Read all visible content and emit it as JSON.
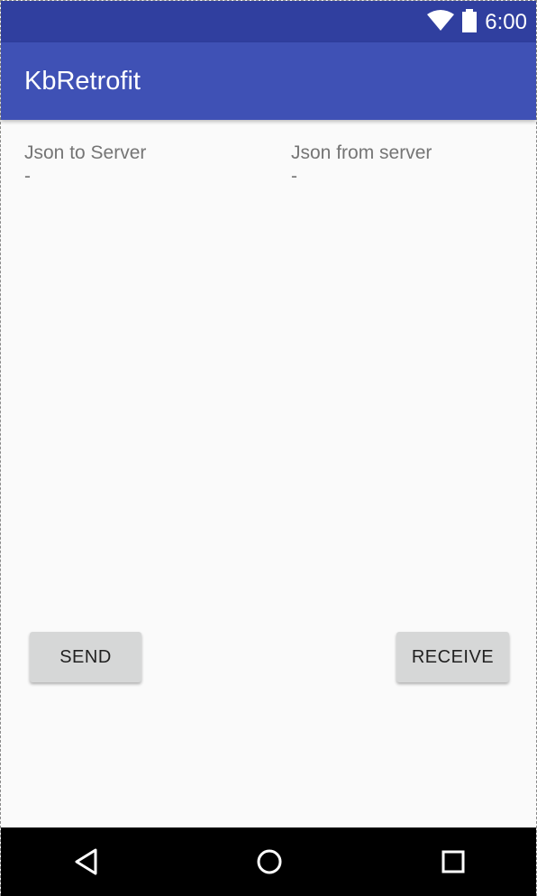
{
  "status_bar": {
    "time": "6:00",
    "icons": [
      "wifi-icon",
      "battery-icon"
    ]
  },
  "app_bar": {
    "title": "KbRetrofit"
  },
  "content": {
    "left_column": {
      "label": "Json to Server",
      "value": "-"
    },
    "right_column": {
      "label": "Json from server",
      "value": "-"
    }
  },
  "buttons": {
    "send_label": "SEND",
    "receive_label": "RECEIVE"
  },
  "navigation": {
    "icons": [
      "back-icon",
      "home-icon",
      "recents-icon"
    ]
  },
  "colors": {
    "status_bar": "#303f9f",
    "app_bar": "#3f51b5",
    "background": "#fafafa",
    "button": "#d6d7d7",
    "nav_bar": "#000000"
  }
}
